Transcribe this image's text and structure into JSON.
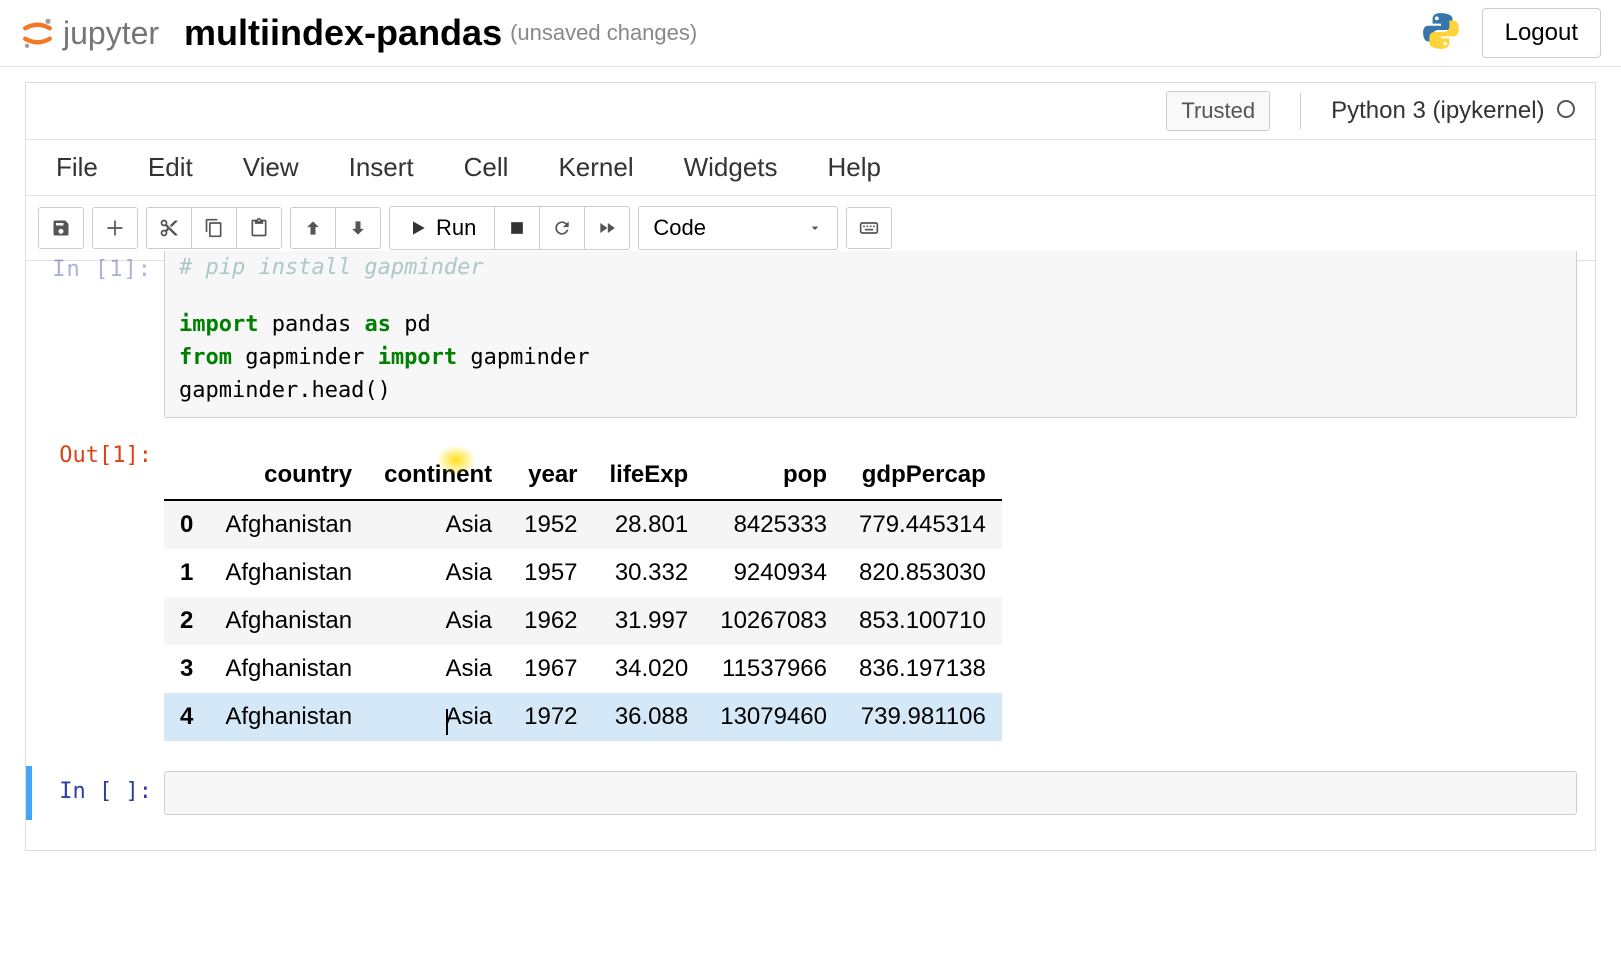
{
  "header": {
    "logo_text": "jupyter",
    "notebook_name": "multiindex-pandas",
    "unsaved_label": "(unsaved changes)",
    "logout_label": "Logout"
  },
  "kernel_bar": {
    "trusted_label": "Trusted",
    "kernel_name": "Python 3 (ipykernel)"
  },
  "menu": {
    "file": "File",
    "edit": "Edit",
    "view": "View",
    "insert": "Insert",
    "cell": "Cell",
    "kernel": "Kernel",
    "widgets": "Widgets",
    "help": "Help"
  },
  "toolbar": {
    "run_label": "Run",
    "cell_type": "Code"
  },
  "cell1": {
    "in_prompt": "In [1]:",
    "out_prompt": "Out[1]:",
    "comment": "# pip install gapminder",
    "l1_import": "import",
    "l1_pandas": " pandas ",
    "l1_as": "as",
    "l1_pd": " pd",
    "l2_from": "from",
    "l2_gap": " gapminder ",
    "l2_import": "import",
    "l2_gap2": " gapminder",
    "l3": "gapminder.head()"
  },
  "table": {
    "columns": [
      "",
      "country",
      "continent",
      "year",
      "lifeExp",
      "pop",
      "gdpPercap"
    ],
    "rows": [
      {
        "idx": "0",
        "country": "Afghanistan",
        "continent": "Asia",
        "year": "1952",
        "lifeExp": "28.801",
        "pop": "8425333",
        "gdpPercap": "779.445314"
      },
      {
        "idx": "1",
        "country": "Afghanistan",
        "continent": "Asia",
        "year": "1957",
        "lifeExp": "30.332",
        "pop": "9240934",
        "gdpPercap": "820.853030"
      },
      {
        "idx": "2",
        "country": "Afghanistan",
        "continent": "Asia",
        "year": "1962",
        "lifeExp": "31.997",
        "pop": "10267083",
        "gdpPercap": "853.100710"
      },
      {
        "idx": "3",
        "country": "Afghanistan",
        "continent": "Asia",
        "year": "1967",
        "lifeExp": "34.020",
        "pop": "11537966",
        "gdpPercap": "836.197138"
      },
      {
        "idx": "4",
        "country": "Afghanistan",
        "continent": "Asia",
        "year": "1972",
        "lifeExp": "36.088",
        "pop": "13079460",
        "gdpPercap": "739.981106"
      }
    ]
  },
  "cell2": {
    "in_prompt": "In [ ]:"
  }
}
